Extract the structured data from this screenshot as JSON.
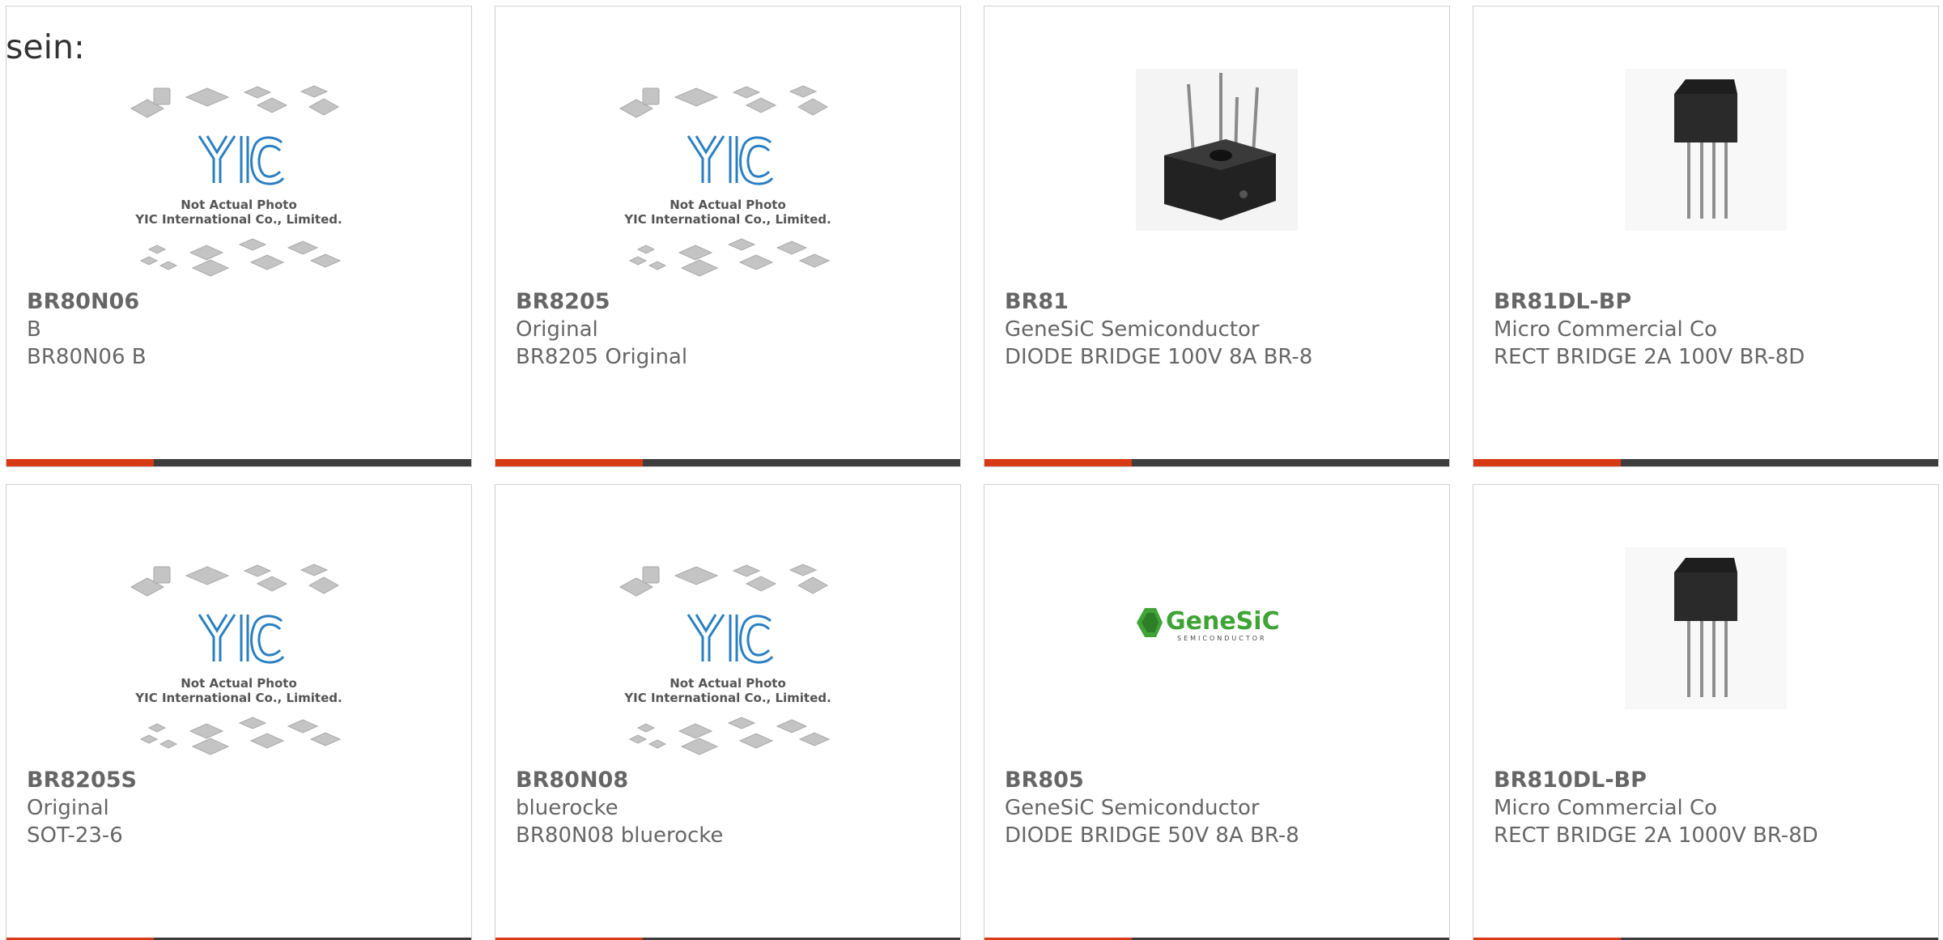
{
  "intro_text": "sein:",
  "colors": {
    "accent": "#d83b14",
    "bar": "#3d3d3d",
    "text": "#666666",
    "yic_logo": "#2a7fc1",
    "genesic_green": "#3fa435"
  },
  "placeholder_image": {
    "line1": "Not Actual Photo",
    "line2": "YIC International Co., Limited."
  },
  "genesic_logo": {
    "brand": "GeneSiC",
    "sub": "SEMICONDUCTOR"
  },
  "products": [
    {
      "part_number": "BR80N06",
      "manufacturer": "B",
      "description": "BR80N06 B",
      "image": "yic-placeholder"
    },
    {
      "part_number": "BR8205",
      "manufacturer": "Original",
      "description": "BR8205 Original",
      "image": "yic-placeholder"
    },
    {
      "part_number": "BR81",
      "manufacturer": "GeneSiC Semiconductor",
      "description": "DIODE BRIDGE 100V 8A BR-8",
      "image": "bridge-rectifier-square"
    },
    {
      "part_number": "BR81DL-BP",
      "manufacturer": "Micro Commercial Co",
      "description": "RECT BRIDGE 2A 100V BR-8D",
      "image": "bridge-rectifier-sip"
    },
    {
      "part_number": "BR8205S",
      "manufacturer": "Original",
      "description": "SOT-23-6",
      "image": "yic-placeholder"
    },
    {
      "part_number": "BR80N08",
      "manufacturer": "bluerocke",
      "description": "BR80N08 bluerocke",
      "image": "yic-placeholder"
    },
    {
      "part_number": "BR805",
      "manufacturer": "GeneSiC Semiconductor",
      "description": "DIODE BRIDGE 50V 8A BR-8",
      "image": "genesic-logo"
    },
    {
      "part_number": "BR810DL-BP",
      "manufacturer": "Micro Commercial Co",
      "description": "RECT BRIDGE 2A 1000V BR-8D",
      "image": "bridge-rectifier-sip"
    }
  ]
}
